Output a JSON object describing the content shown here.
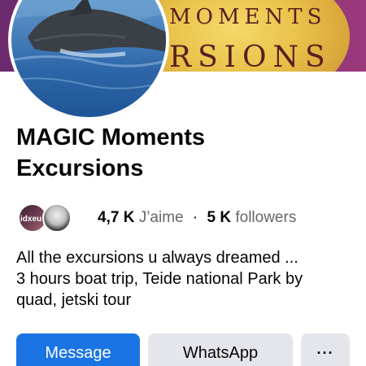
{
  "cover": {
    "banner_line1": "MOMENTS",
    "banner_line2": "RSIONS"
  },
  "page": {
    "name_line1": "MAGIC Moments",
    "name_line2": "Excursions"
  },
  "stats": {
    "mini_avatar_text": "idxeu",
    "likes_count": "4,7 K",
    "likes_label": "J’aime",
    "separator": "·",
    "followers_count": "5 K",
    "followers_label": "followers"
  },
  "description": {
    "line1": "All the excursions u always dreamed ...",
    "line2": "3 hours boat trip, Teide national Park by",
    "line3": "quad,  jetski tour"
  },
  "actions": {
    "message_label": "Message",
    "whatsapp_label": "WhatsApp",
    "more_label": "···"
  },
  "colors": {
    "primary_button": "#1b74e4",
    "secondary_button": "#e4e6eb",
    "cover_purple": "#7c2c79",
    "cover_gold": "#e9c24a"
  },
  "icons": {
    "more": "more-horizontal-icon"
  }
}
